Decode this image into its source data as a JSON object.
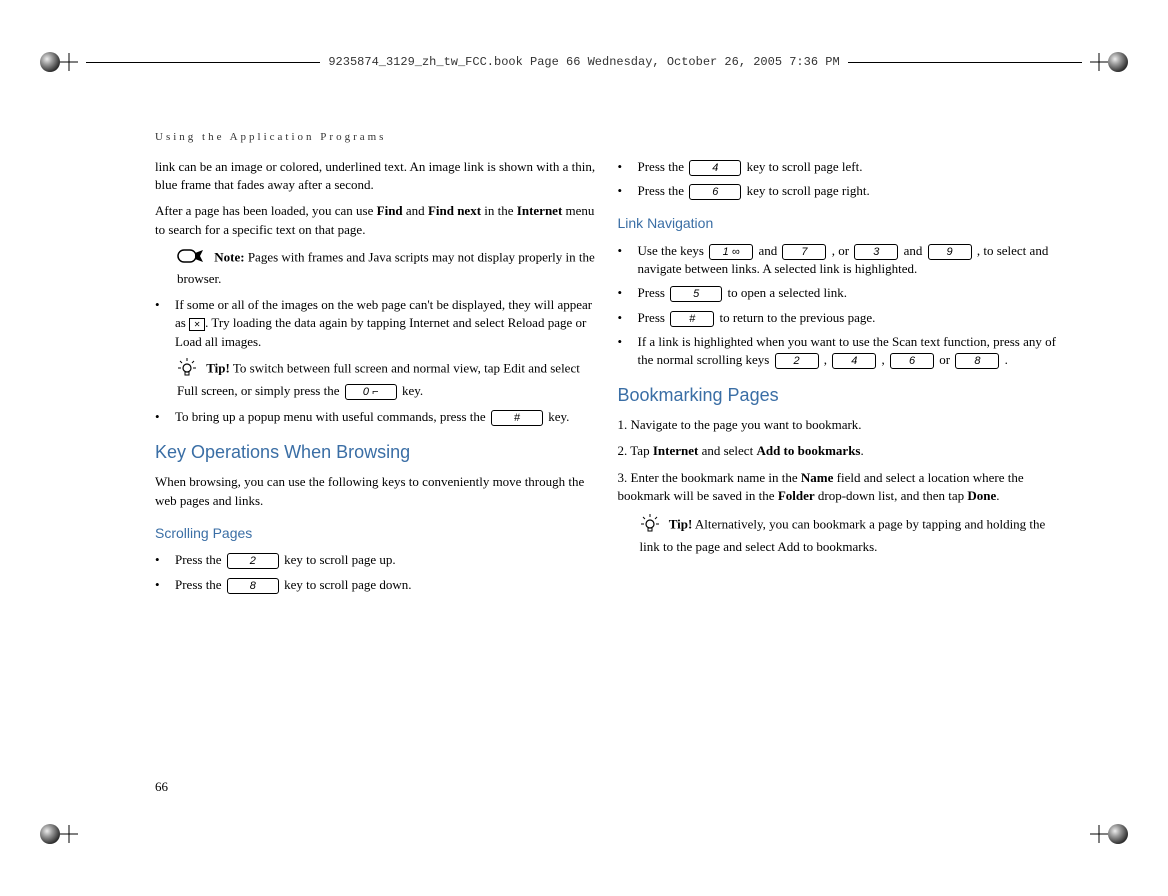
{
  "frameMaker": {
    "headerText": "9235874_3129_zh_tw_FCC.book  Page 66  Wednesday, October 26, 2005  7:36 PM"
  },
  "runningHeader": "Using the Application Programs",
  "pageNumber": "66",
  "left": {
    "p1a": "link can be an image or colored, underlined text. An image link is shown with a thin, blue frame that fades away after a second.",
    "p2_pre": "After a page has been loaded, you can use ",
    "p2_b1": "Find",
    "p2_mid": " and ",
    "p2_b2": "Find next",
    "p2_post_pre": " in the ",
    "p2_b3": "Internet",
    "p2_post": " menu to search for a specific text on that page.",
    "note_label": "Note:",
    "note_text": " Pages with frames and Java scripts may not dis­play properly in the browser.",
    "bullet1_pre": "If some or all of the images on the web page can't be dis­played, they will appear as ",
    "bullet1_post": ". Try loading the data again by tapping Internet and select Reload page or Load all images.",
    "tip_label": "Tip!",
    "tip1_pre": " To switch between full screen and normal view, tap Edit and select Full screen, or simply press the ",
    "tip1_key": "0 ⌐",
    "tip1_post": " key.",
    "bullet2_pre": "To bring up a popup menu with useful commands, press the ",
    "bullet2_key": "#",
    "bullet2_post": " key.",
    "h1": "Key Operations When Browsing",
    "h1_sub": "When browsing, you can use the following keys to conveniently move through the web pages and links.",
    "h2": "Scrolling Pages",
    "scroll_up_pre": "Press the ",
    "scroll_up_key": "2",
    "scroll_up_post": " key to scroll page up.",
    "scroll_down_pre": "Press the ",
    "scroll_down_key": "8",
    "scroll_down_post": " key to scroll page down."
  },
  "right": {
    "scroll_left_pre": "Press the ",
    "scroll_left_key": "4",
    "scroll_left_post": " key to scroll page left.",
    "scroll_right_pre": "Press the ",
    "scroll_right_key": "6",
    "scroll_right_post": " key to scroll page right.",
    "h3": "Link Navigation",
    "nav1_pre": "Use the keys ",
    "nav1_k1": "1 ∞",
    "nav1_and1": " and ",
    "nav1_k2": "7",
    "nav1_or": " , or ",
    "nav1_k3": "3",
    "nav1_and2": " and ",
    "nav1_k4": "9",
    "nav1_post": " , to select and navigate between links. A selected link is highlighted.",
    "nav2_pre": "Press ",
    "nav2_key": "5",
    "nav2_post": " to open a selected link.",
    "nav3_pre": "Press ",
    "nav3_key": "#",
    "nav3_post": " to return to the previous page.",
    "nav4_pre": "If a link is highlighted when you want to use the Scan text function, press any of the normal scrolling keys ",
    "nav4_k1": "2",
    "nav4_c1": " , ",
    "nav4_k2": "4",
    "nav4_c2": " , ",
    "nav4_k3": "6",
    "nav4_c3": " or ",
    "nav4_k4": "8",
    "nav4_post": " .",
    "h4": "Bookmarking Pages",
    "bm1": "1. Navigate to the page you want to bookmark.",
    "bm2_pre": "2. Tap ",
    "bm2_b1": "Internet",
    "bm2_mid": " and select ",
    "bm2_b2": "Add to bookmarks",
    "bm2_post": ".",
    "bm3_pre": "3. Enter the bookmark name in the ",
    "bm3_b1": "Name",
    "bm3_mid": " field and select a location where the bookmark will be saved in the ",
    "bm3_b2": "Folder",
    "bm3_mid2": " drop-down list, and then tap ",
    "bm3_b3": "Done",
    "bm3_post": ".",
    "tip2_label": "Tip!",
    "tip2": " Alternatively, you can bookmark a page by tapping and holding the link to the page and select Add to book­marks."
  }
}
